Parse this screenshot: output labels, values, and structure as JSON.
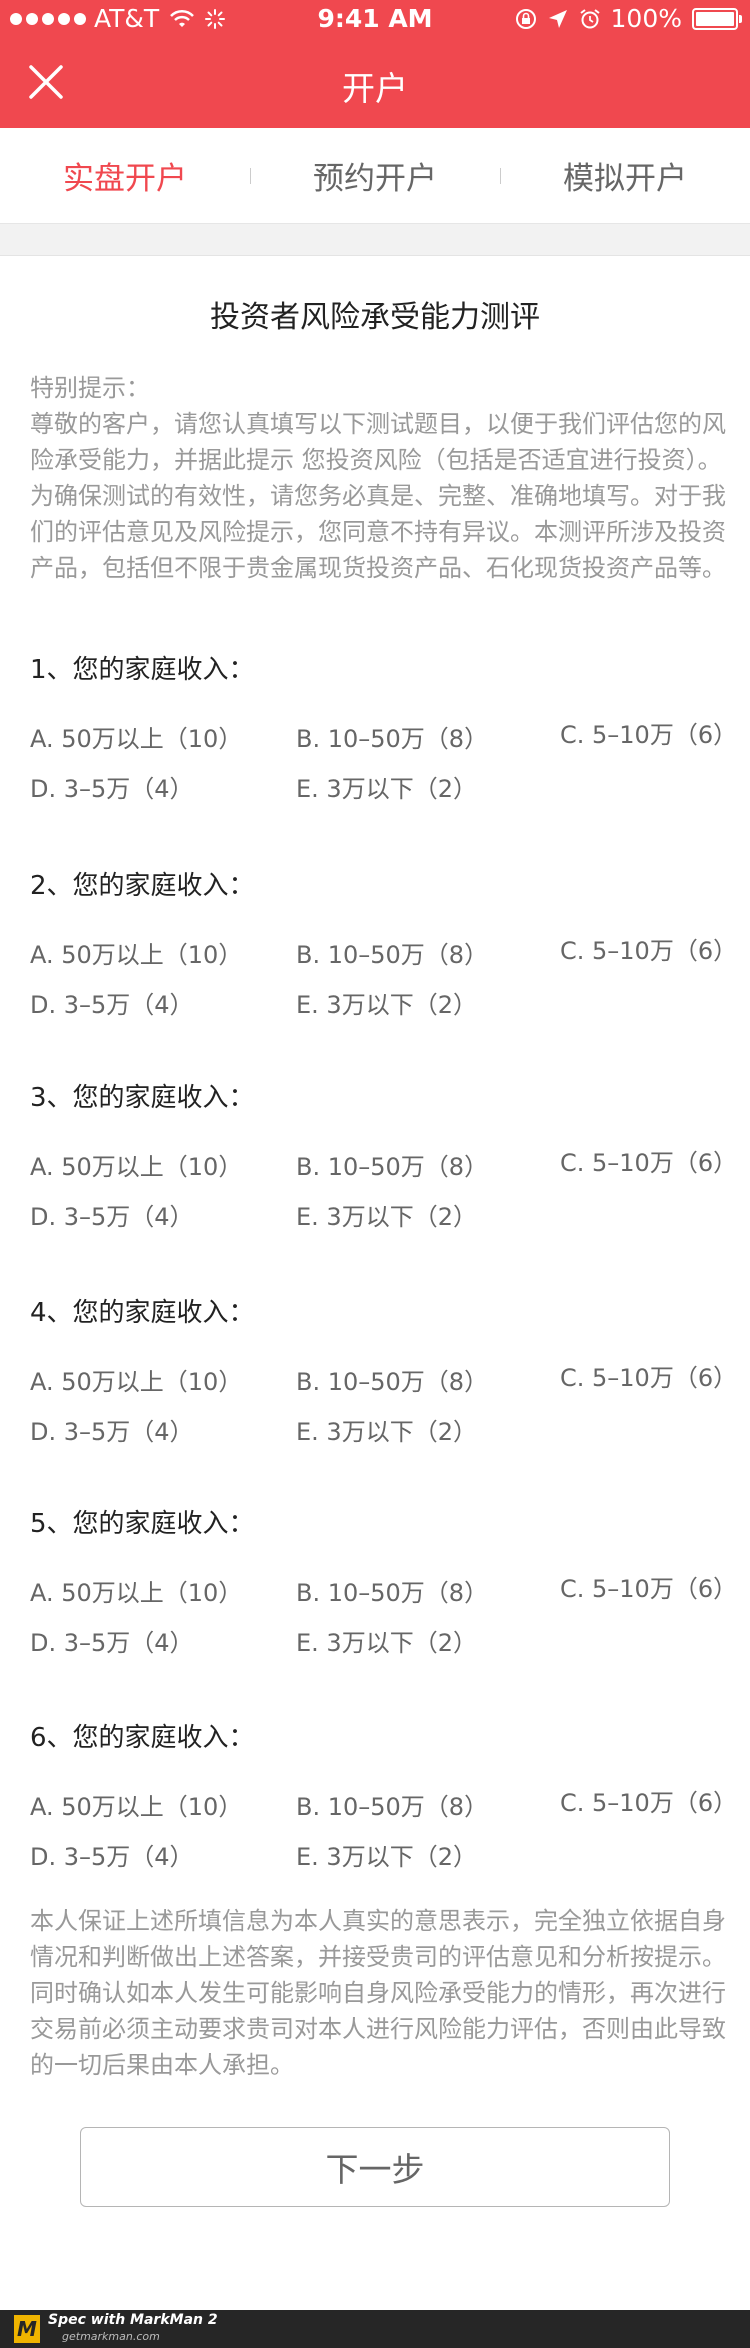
{
  "status_bar": {
    "carrier": "AT&T",
    "time": "9:41 AM",
    "battery": "100%"
  },
  "nav": {
    "title": "开户",
    "close_icon": "close-icon"
  },
  "tabs": [
    {
      "label": "实盘开户",
      "active": true
    },
    {
      "label": "预约开户",
      "active": false
    },
    {
      "label": "模拟开户",
      "active": false
    }
  ],
  "survey": {
    "title": "投资者风险承受能力测评",
    "notice_heading": "特别提示：",
    "notice_body": "尊敬的客户，请您认真填写以下测试题目，以便于我们评估您的风险承受能力，并据此提示 您投资风险（包括是否适宜进行投资）。为确保测试的有效性，请您务必真是、完整、准确地填写。对于我们的评估意见及风险提示，您同意不持有异议。本测评所涉及投资产品，包括但不限于贵金属现货投资产品、石化现货投资产品等。"
  },
  "questions": [
    {
      "label": "1、您的家庭收入：",
      "options": [
        "A. 50万以上（10）",
        "B. 10–50万（8）",
        "C. 5–10万（6）",
        "D. 3–5万（4）",
        "E. 3万以下（2）"
      ]
    },
    {
      "label": "2、您的家庭收入：",
      "options": [
        "A. 50万以上（10）",
        "B. 10–50万（8）",
        "C. 5–10万（6）",
        "D. 3–5万（4）",
        "E. 3万以下（2）"
      ]
    },
    {
      "label": "3、您的家庭收入：",
      "options": [
        "A. 50万以上（10）",
        "B. 10–50万（8）",
        "C. 5–10万（6）",
        "D. 3–5万（4）",
        "E. 3万以下（2）"
      ]
    },
    {
      "label": "4、您的家庭收入：",
      "options": [
        "A. 50万以上（10）",
        "B. 10–50万（8）",
        "C. 5–10万（6）",
        "D. 3–5万（4）",
        "E. 3万以下（2）"
      ]
    },
    {
      "label": "5、您的家庭收入：",
      "options": [
        "A. 50万以上（10）",
        "B. 10–50万（8）",
        "C. 5–10万（6）",
        "D. 3–5万（4）",
        "E. 3万以下（2）"
      ]
    },
    {
      "label": "6、您的家庭收入：",
      "options": [
        "A. 50万以上（10）",
        "B. 10–50万（8）",
        "C. 5–10万（6）",
        "D. 3–5万（4）",
        "E. 3万以下（2）"
      ]
    }
  ],
  "declaration": "本人保证上述所填信息为本人真实的意思表示，完全独立依据自身情况和判断做出上述答案，并接受贵司的评估意见和分析按提示。同时确认如本人发生可能影响自身风险承受能力的情形，再次进行交易前必须主动要求贵司对本人进行风险能力评估，否则由此导致的一切后果由本人承担。",
  "next_button": {
    "label": "下一步"
  },
  "footer": {
    "brand": "Spec with MarkMan 2",
    "site": "getmarkman.com",
    "logo_letter": "M"
  },
  "colors": {
    "header_red": "#f0484f",
    "title_text": "#222222",
    "option_text": "#666666",
    "notice_text": "#999999",
    "button_border": "#b5b5b5"
  }
}
